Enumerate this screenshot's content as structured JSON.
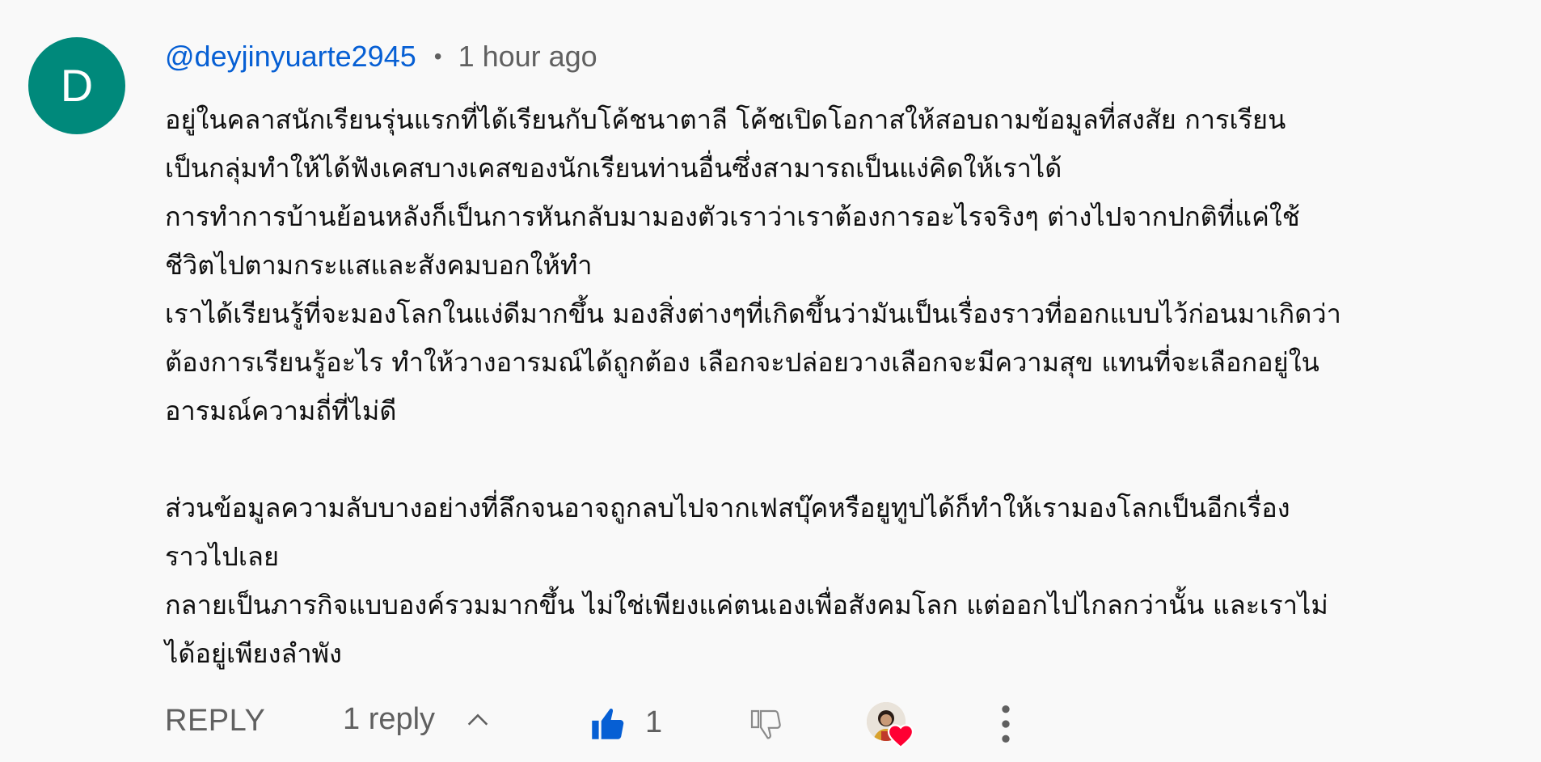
{
  "comment": {
    "avatar_letter": "D",
    "avatar_color": "#00897b",
    "author": "@deyjinyuarte2945",
    "separator": "•",
    "time": "1 hour ago",
    "body_lines": [
      "อยู่ในคลาสนักเรียนรุ่นแรกที่ได้เรียนกับโค้ชนาตาลี โค้ชเปิดโอกาสให้สอบถามข้อมูลที่สงสัย การเรียน",
      "เป็นกลุ่มทำให้ได้ฟังเคสบางเคสของนักเรียนท่านอื่นซึ่งสามารถเป็นแง่คิดให้เราได้",
      "การทำการบ้านย้อนหลังก็เป็นการหันกลับมามองตัวเราว่าเราต้องการอะไรจริงๆ ต่างไปจากปกติที่แค่ใช้",
      "ชีวิตไปตามกระแสและสังคมบอกให้ทำ",
      "เราได้เรียนรู้ที่จะมองโลกในแง่ดีมากขึ้น มองสิ่งต่างๆที่เกิดขึ้นว่ามันเป็นเรื่องราวที่ออกแบบไว้ก่อนมาเกิดว่า",
      "ต้องการเรียนรู้อะไร ทำให้วางอารมณ์ได้ถูกต้อง เลือกจะปล่อยวางเลือกจะมีความสุข แทนที่จะเลือกอยู่ใน",
      "อารมณ์ความถี่ที่ไม่ดี",
      "",
      "ส่วนข้อมูลความลับบางอย่างที่ลึกจนอาจถูกลบไปจากเฟสบุ๊คหรือยูทูปได้ก็ทำให้เรามองโลกเป็นอีกเรื่อง",
      "ราวไปเลย",
      "กลายเป็นภารกิจแบบองค์รวมมากขึ้น ไม่ใช่เพียงแค่ตนเองเพื่อสังคมโลก แต่ออกไปไกลกว่านั้น และเราไม่",
      "ได้อยู่เพียงลำพัง"
    ]
  },
  "toolbar": {
    "reply_label": "REPLY",
    "replies_label": "1 reply",
    "replies_icon": "chevron-up-icon",
    "like_icon": "thumbs-up-filled-icon",
    "like_count": "1",
    "dislike_icon": "thumbs-down-outline-icon",
    "creator_heart_icon": "creator-heart-badge",
    "more_icon": "more-vertical-icon",
    "like_color": "#065fd4",
    "heart_color": "#ff0033"
  }
}
